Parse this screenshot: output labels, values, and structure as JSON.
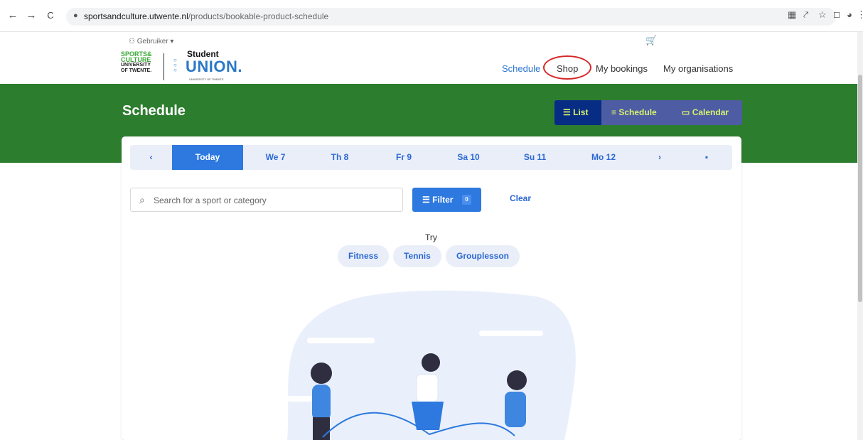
{
  "browser": {
    "back_icon": "←",
    "forward_icon": "→",
    "reload_icon": "C",
    "lock_icon": "🔒",
    "url_host": "sportsandculture.utwente.nl",
    "url_path": "/products/bookable-product-schedule"
  },
  "header": {
    "user_label": "Gebruiker",
    "cart_icon": "cart-icon",
    "logo_left": [
      "SPORTS&",
      "CULTURE",
      "UNIVERSITY",
      "OF TWENTE."
    ],
    "logo_right_top": "Student",
    "logo_right_bottom": "UNION.",
    "logo_right_tiny": "UNIVERSITY OF TWENTE.",
    "nav": [
      "Schedule",
      "Shop",
      "My bookings",
      "My organisations"
    ]
  },
  "page": {
    "title": "Schedule",
    "views": [
      "List",
      "Schedule",
      "Calendar"
    ]
  },
  "days": {
    "prev": "‹",
    "items": [
      "Today",
      "We 7",
      "Th 8",
      "Fr 9",
      "Sa 10",
      "Su 11",
      "Mo 12"
    ],
    "next": "›",
    "calendar_icon": "calendar-icon"
  },
  "search": {
    "placeholder": "Search for a sport or category",
    "filter_label": "Filter",
    "filter_count": "0",
    "clear_label": "Clear"
  },
  "suggestions": {
    "label": "Try",
    "items": [
      "Fitness",
      "Tennis",
      "Grouplesson"
    ]
  },
  "colors": {
    "green": "#2d7d2f",
    "blue": "#2d79df",
    "navy": "#072c83",
    "purple": "#4d5ca3",
    "accent_yellow": "#d9f36d"
  }
}
